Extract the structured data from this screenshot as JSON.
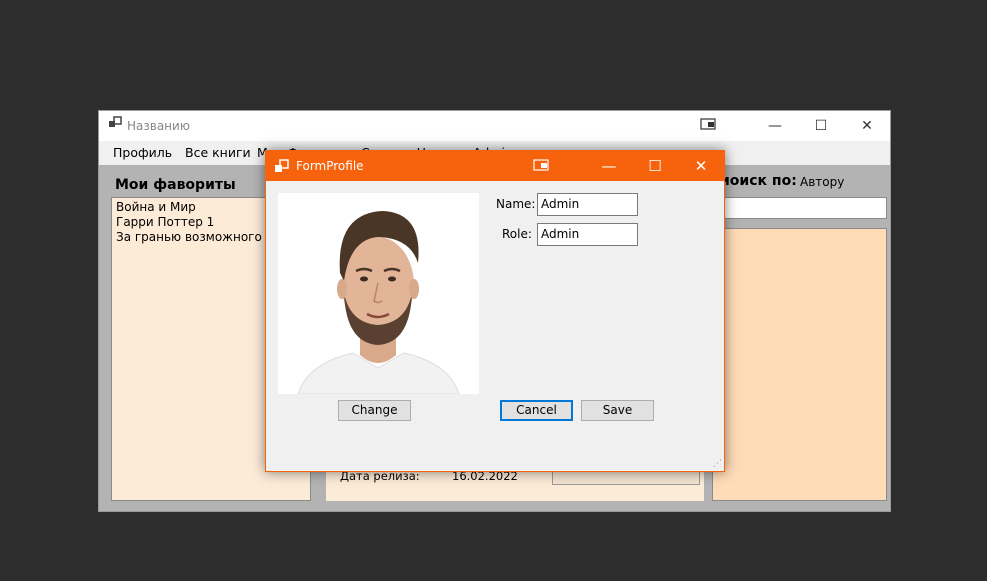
{
  "main_window": {
    "title": "Названию",
    "menu": [
      "Профиль",
      "Все книги",
      "Мои Ф",
      "",
      "Сортир. Н",
      "Admin"
    ],
    "favorites_title": "Мои фавориты",
    "favorites": [
      "Война и Мир",
      "Гарри Поттер 1",
      "За гранью возможного"
    ],
    "release_label": "Дата релиза:",
    "release_value": "16.02.2022",
    "search_label": "иоиск по:",
    "search_by": "Автору",
    "search_value": ""
  },
  "dialog": {
    "title": "FormProfile",
    "name_label": "Name:",
    "name_value": "Admin",
    "role_label": "Role:",
    "role_value": "Admin",
    "change_label": "Change",
    "cancel_label": "Cancel",
    "save_label": "Save"
  },
  "icons": {
    "app": "window-icon",
    "snap": "snap-layout-icon",
    "minimize": "minimize-icon",
    "maximize": "maximize-icon",
    "close": "close-icon"
  },
  "colors": {
    "accent": "#f7630c",
    "favorites_bg": "#fcebd7",
    "results_bg": "#fedcb8",
    "focus": "#0078d7"
  }
}
